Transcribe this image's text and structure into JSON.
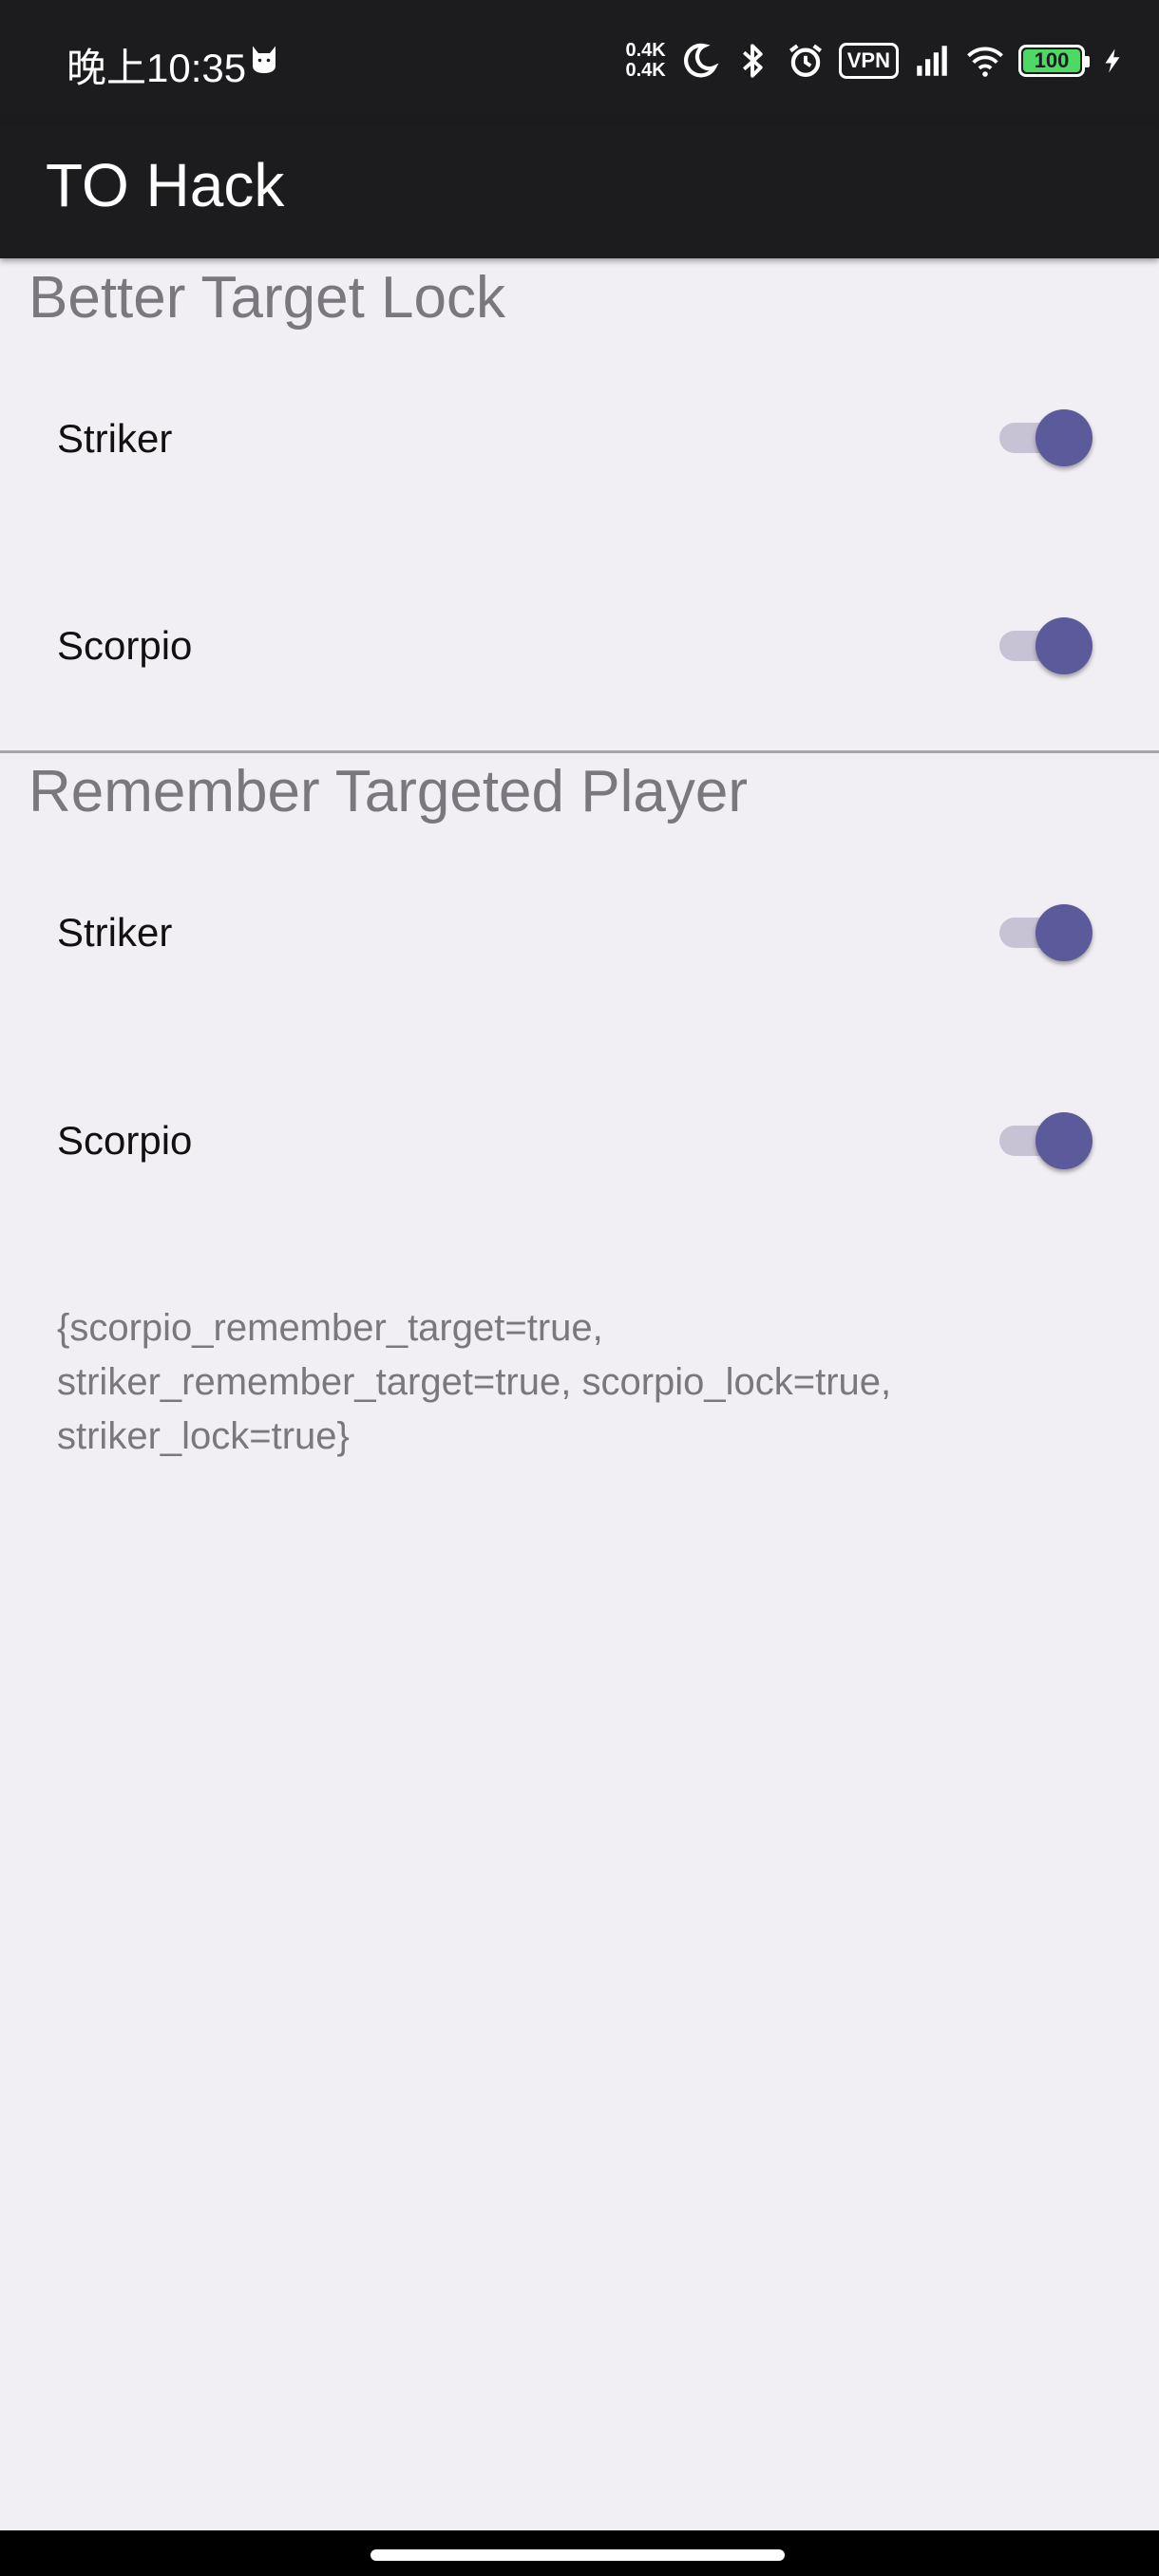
{
  "status_bar": {
    "time": "晚上10:35",
    "speed_up": "0.4K",
    "speed_down": "0.4K",
    "vpn": "VPN",
    "battery": "100",
    "battery_level": 1.0
  },
  "app_bar": {
    "title": "TO Hack"
  },
  "sections": [
    {
      "header": "Better Target Lock",
      "rows": [
        {
          "label": "Striker",
          "checked": true
        },
        {
          "label": "Scorpio",
          "checked": true
        }
      ]
    },
    {
      "header": "Remember Targeted Player",
      "rows": [
        {
          "label": "Striker",
          "checked": true
        },
        {
          "label": "Scorpio",
          "checked": true
        }
      ]
    }
  ],
  "prefs_dump": "{scorpio_remember_target=true, striker_remember_target=true, scorpio_lock=true, striker_lock=true}",
  "colors": {
    "accent": "#5b5a9b",
    "track": "#c7c3d4",
    "background": "#f2eff4",
    "app_bar": "#1c1c1e"
  }
}
